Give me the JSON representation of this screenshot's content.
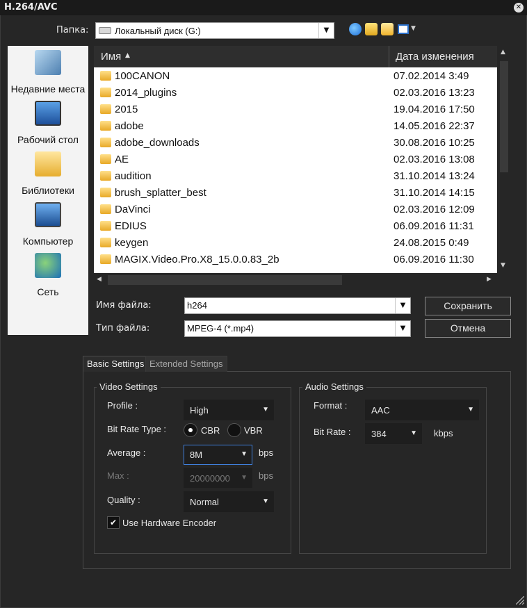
{
  "window": {
    "title": "H.264/AVC"
  },
  "toolbar": {
    "folder_label": "Папка:",
    "folder_value": "Локальный диск (G:)"
  },
  "places": [
    {
      "label": "Недавние места",
      "icon": "recent-places-icon"
    },
    {
      "label": "Рабочий стол",
      "icon": "desktop-icon"
    },
    {
      "label": "Библиотеки",
      "icon": "libraries-icon"
    },
    {
      "label": "Компьютер",
      "icon": "computer-icon"
    },
    {
      "label": "Сеть",
      "icon": "network-icon"
    }
  ],
  "filelist": {
    "col_name": "Имя",
    "col_date": "Дата изменения",
    "rows": [
      {
        "name": "100CANON",
        "date": "07.02.2014 3:49"
      },
      {
        "name": "2014_plugins",
        "date": "02.03.2016 13:23"
      },
      {
        "name": "2015",
        "date": "19.04.2016 17:50"
      },
      {
        "name": "adobe",
        "date": "14.05.2016 22:37"
      },
      {
        "name": "adobe_downloads",
        "date": "30.08.2016 10:25"
      },
      {
        "name": "AE",
        "date": "02.03.2016 13:08"
      },
      {
        "name": "audition",
        "date": "31.10.2014 13:24"
      },
      {
        "name": "brush_splatter_best",
        "date": "31.10.2014 14:15"
      },
      {
        "name": "DaVinci",
        "date": "02.03.2016 12:09"
      },
      {
        "name": "EDIUS",
        "date": "06.09.2016 11:31"
      },
      {
        "name": "keygen",
        "date": "24.08.2015 0:49"
      },
      {
        "name": "MAGIX.Video.Pro.X8_15.0.0.83_2b",
        "date": "06.09.2016 11:30"
      }
    ]
  },
  "file_name": {
    "label": "Имя файла:",
    "value": "h264"
  },
  "file_type": {
    "label": "Тип файла:",
    "value": "MPEG-4 (*.mp4)"
  },
  "buttons": {
    "save": "Сохранить",
    "cancel": "Отмена"
  },
  "tabs": {
    "basic": "Basic Settings",
    "extended": "Extended Settings"
  },
  "video": {
    "title": "Video Settings",
    "profile_label": "Profile :",
    "profile_value": "High",
    "bitrate_type_label": "Bit Rate Type :",
    "cbr": "CBR",
    "vbr": "VBR",
    "average_label": "Average :",
    "average_value": "8M",
    "average_unit": "bps",
    "max_label": "Max :",
    "max_value": "20000000",
    "max_unit": "bps",
    "quality_label": "Quality :",
    "quality_value": "Normal",
    "hw_encoder_label": "Use Hardware Encoder"
  },
  "audio": {
    "title": "Audio Settings",
    "format_label": "Format :",
    "format_value": "AAC",
    "bitrate_label": "Bit Rate :",
    "bitrate_value": "384",
    "bitrate_unit": "kbps"
  }
}
